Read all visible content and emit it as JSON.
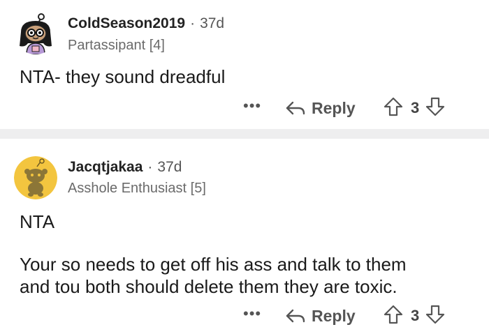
{
  "comments": [
    {
      "username": "ColdSeason2019",
      "separator": "·",
      "age": "37d",
      "flair": "Partassipant [4]",
      "body": [
        "NTA- they sound dreadful"
      ],
      "more_label": "•••",
      "reply_label": "Reply",
      "vote_count": "3",
      "avatar_icon": "snoo-avatar-girl-with-glasses-icon"
    },
    {
      "username": "Jacqtjakaa",
      "separator": "·",
      "age": "37d",
      "flair": "Asshole Enthusiast [5]",
      "body": [
        "NTA",
        "Your so needs to get off his ass and talk to them",
        "and tou both should delete them they are toxic."
      ],
      "more_label": "•••",
      "reply_label": "Reply",
      "vote_count": "3",
      "avatar_icon": "default-snoo-avatar-icon",
      "avatar_bg": "#f3c53f"
    }
  ],
  "colors": {
    "divider": "#eeeeef",
    "muted_text": "#555555"
  }
}
